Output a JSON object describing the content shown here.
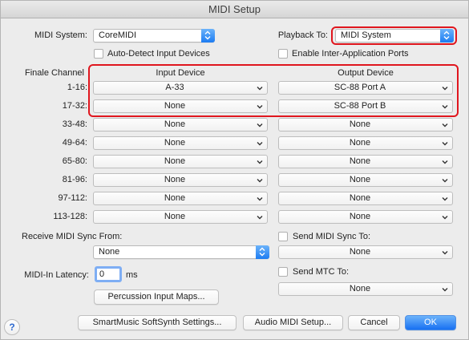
{
  "window": {
    "title": "MIDI Setup"
  },
  "midi_system": {
    "label": "MIDI System:",
    "value": "CoreMIDI"
  },
  "playback_to": {
    "label": "Playback To:",
    "value": "MIDI System"
  },
  "auto_detect": {
    "label": "Auto-Detect Input Devices"
  },
  "inter_app": {
    "label": "Enable Inter-Application Ports"
  },
  "channels": {
    "header": "Finale Channel",
    "input_header": "Input Device",
    "output_header": "Output Device",
    "rows": [
      {
        "label": "1-16:",
        "input": "A-33",
        "output": "SC-88 Port A"
      },
      {
        "label": "17-32:",
        "input": "None",
        "output": "SC-88 Port B"
      },
      {
        "label": "33-48:",
        "input": "None",
        "output": "None"
      },
      {
        "label": "49-64:",
        "input": "None",
        "output": "None"
      },
      {
        "label": "65-80:",
        "input": "None",
        "output": "None"
      },
      {
        "label": "81-96:",
        "input": "None",
        "output": "None"
      },
      {
        "label": "97-112:",
        "input": "None",
        "output": "None"
      },
      {
        "label": "113-128:",
        "input": "None",
        "output": "None"
      }
    ]
  },
  "receive_sync": {
    "label": "Receive MIDI Sync From:",
    "value": "None"
  },
  "send_sync": {
    "label": "Send MIDI Sync To:",
    "value": "None"
  },
  "midi_in_latency": {
    "label": "MIDI-In Latency:",
    "value": "0",
    "unit": "ms"
  },
  "send_mtc": {
    "label": "Send MTC To:",
    "value": "None"
  },
  "buttons": {
    "percussion": "Percussion Input Maps...",
    "smartmusic": "SmartMusic SoftSynth Settings...",
    "audio_midi": "Audio MIDI Setup...",
    "cancel": "Cancel",
    "ok": "OK",
    "help": "?"
  },
  "colors": {
    "highlight": "#e0161e",
    "accent": "#1d7cf2"
  }
}
